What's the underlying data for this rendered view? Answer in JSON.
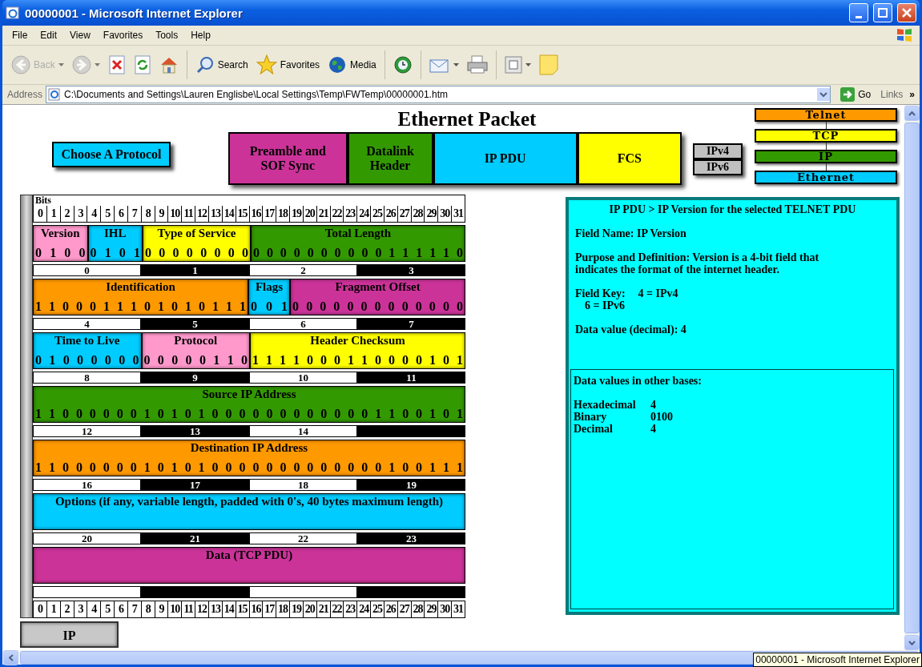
{
  "window": {
    "title": "00000001 - Microsoft Internet Explorer"
  },
  "menu": [
    "File",
    "Edit",
    "View",
    "Favorites",
    "Tools",
    "Help"
  ],
  "toolbar": [
    {
      "kind": "back",
      "label": "Back",
      "disabled": true,
      "has_menu": true
    },
    {
      "kind": "forward",
      "disabled": true,
      "has_menu": true
    },
    {
      "kind": "stop",
      "disabled": false,
      "has_menu": false
    },
    {
      "kind": "refresh",
      "disabled": false,
      "has_menu": false
    },
    {
      "kind": "home",
      "disabled": false,
      "has_menu": false
    },
    {
      "kind": "search",
      "label": "Search",
      "disabled": false,
      "has_menu": false
    },
    {
      "kind": "favorites",
      "label": "Favorites",
      "disabled": false,
      "has_menu": false
    },
    {
      "kind": "media",
      "label": "Media",
      "disabled": false,
      "has_menu": false
    },
    {
      "kind": "history",
      "disabled": false,
      "has_menu": false
    },
    {
      "kind": "mail",
      "disabled": false,
      "has_menu": true
    },
    {
      "kind": "print",
      "disabled": false,
      "has_menu": false
    },
    {
      "kind": "edit",
      "disabled": false,
      "has_menu": true
    },
    {
      "kind": "note",
      "disabled": false,
      "has_menu": false
    }
  ],
  "address": {
    "label": "Address",
    "url": "C:\\Documents and Settings\\Lauren Englisbe\\Local Settings\\Temp\\FWTemp\\00000001.htm",
    "go": "Go",
    "links": "Links",
    "more": "»"
  },
  "page": {
    "title": "Ethernet Packet",
    "choose_button": "Choose A Protocol",
    "segments": [
      {
        "label": "Preamble and SOF Sync",
        "color": "#cc3399"
      },
      {
        "label": "Datalink Header",
        "color": "#339900"
      },
      {
        "label": "IP PDU",
        "color": "#00ccff"
      },
      {
        "label": "FCS",
        "color": "#ffff00"
      }
    ],
    "versions": [
      "IPv4",
      "IPv6"
    ],
    "stack": [
      {
        "label": "Telnet",
        "color": "#ff9900"
      },
      {
        "label": "TCP",
        "color": "#ffff00"
      },
      {
        "label": "IP",
        "color": "#339900"
      },
      {
        "label": "Ethernet",
        "color": "#00ccff"
      }
    ]
  },
  "diagram": {
    "bits_label": "Bits",
    "bit_numbers": [
      "0",
      "1",
      "2",
      "3",
      "4",
      "5",
      "6",
      "7",
      "8",
      "9",
      "10",
      "11",
      "12",
      "13",
      "14",
      "15",
      "16",
      "17",
      "18",
      "19",
      "20",
      "21",
      "22",
      "23",
      "24",
      "25",
      "26",
      "27",
      "28",
      "29",
      "30",
      "31"
    ],
    "rows": [
      {
        "fields": [
          {
            "name": "Version",
            "bits": "0 1 0 0",
            "color": "#ff99cc"
          },
          {
            "name": "IHL",
            "bits": "0 1 0 1",
            "color": "#00ccff"
          },
          {
            "name": "Type of Service",
            "bits": "0 0 0 0 0 0 0 0",
            "color": "#ffff00"
          },
          {
            "name": "Total Length",
            "bits": "0 0 0 0 0 0 0 0 0 0 1 1 1 1 1 0",
            "color": "#339900"
          }
        ],
        "bytes": [
          "0",
          "1",
          "2",
          "3"
        ]
      },
      {
        "fields": [
          {
            "name": "Identification",
            "bits": "1 1 0 0 0 1 1 1 0 1 0 1 0 1 1 1",
            "color": "#ff9900"
          },
          {
            "name": "Flags",
            "bits": "0 0 1",
            "color": "#00ccff"
          },
          {
            "name": "Fragment Offset",
            "bits": "0 0 0 0 0 0 0 0 0 0 0 0 0",
            "color": "#cc3399"
          }
        ],
        "bytes": [
          "4",
          "5",
          "6",
          "7"
        ]
      },
      {
        "fields": [
          {
            "name": "Time to Live",
            "bits": "0 1 0 0 0 0 0 0",
            "color": "#00ccff"
          },
          {
            "name": "Protocol",
            "bits": "0 0 0 0 0 1 1 0",
            "color": "#ff99cc"
          },
          {
            "name": "Header Checksum",
            "bits": "1 1 1 1 0 0 0 1 1 0 0 0 0 1 0 1",
            "color": "#ffff00"
          }
        ],
        "bytes": [
          "8",
          "9",
          "10",
          "11"
        ]
      },
      {
        "fields": [
          {
            "name": "Source IP Address",
            "bits": "1 1 0 0 0 0 0 0 1 0 1 0 1 0 0 0 0 0 0 0 0 0 0 0 0 1 1 0 0 1 0 1",
            "color": "#339900"
          }
        ],
        "bytes": [
          "12",
          "13",
          "14"
        ]
      },
      {
        "fields": [
          {
            "name": "Destination IP Address",
            "bits": "1 1 0 0 0 0 0 0 1 0 1 0 1 0 0 0 0 0 0 0 0 0 0 0 0 0 1 0 0 1 1 1",
            "color": "#ff9900"
          }
        ],
        "bytes": [
          "16",
          "17",
          "18",
          "19"
        ]
      },
      {
        "fields": [
          {
            "name": "Options (if any, variable length, padded with 0's, 40 bytes maximum length)",
            "color": "#00ccff"
          }
        ],
        "bytes": [
          "20",
          "21",
          "22",
          "23"
        ]
      },
      {
        "fields": [
          {
            "name": "Data (TCP PDU)",
            "color": "#cc3399"
          }
        ]
      }
    ],
    "footer_bit_numbers": [
      "0",
      "1",
      "2",
      "3",
      "4",
      "5",
      "6",
      "7",
      "8",
      "9",
      "10",
      "11",
      "12",
      "13",
      "14",
      "15",
      "16",
      "17",
      "18",
      "19",
      "20",
      "21",
      "22",
      "23",
      "24",
      "25",
      "26",
      "27",
      "28",
      "29",
      "30",
      "31"
    ],
    "tab": "IP"
  },
  "details": {
    "heading": "IP PDU > IP Version for the selected TELNET PDU",
    "field_name": "Field Name: IP Version",
    "purpose": "Purpose and Definition:  Version is a 4-bit field that indicates the format of the internet header.",
    "field_key_label": "Field Key:",
    "field_key_values": [
      "4 = IPv4",
      "6 = IPv6"
    ],
    "data_value": "Data value (decimal):  4",
    "bases": {
      "heading": "Data values in other bases:",
      "rows": [
        {
          "label": "Hexadecimal",
          "value": "4"
        },
        {
          "label": "Binary",
          "value": "0100"
        },
        {
          "label": "Decimal",
          "value": "4"
        }
      ]
    }
  },
  "tooltip": "00000001 - Microsoft Internet Explorer"
}
